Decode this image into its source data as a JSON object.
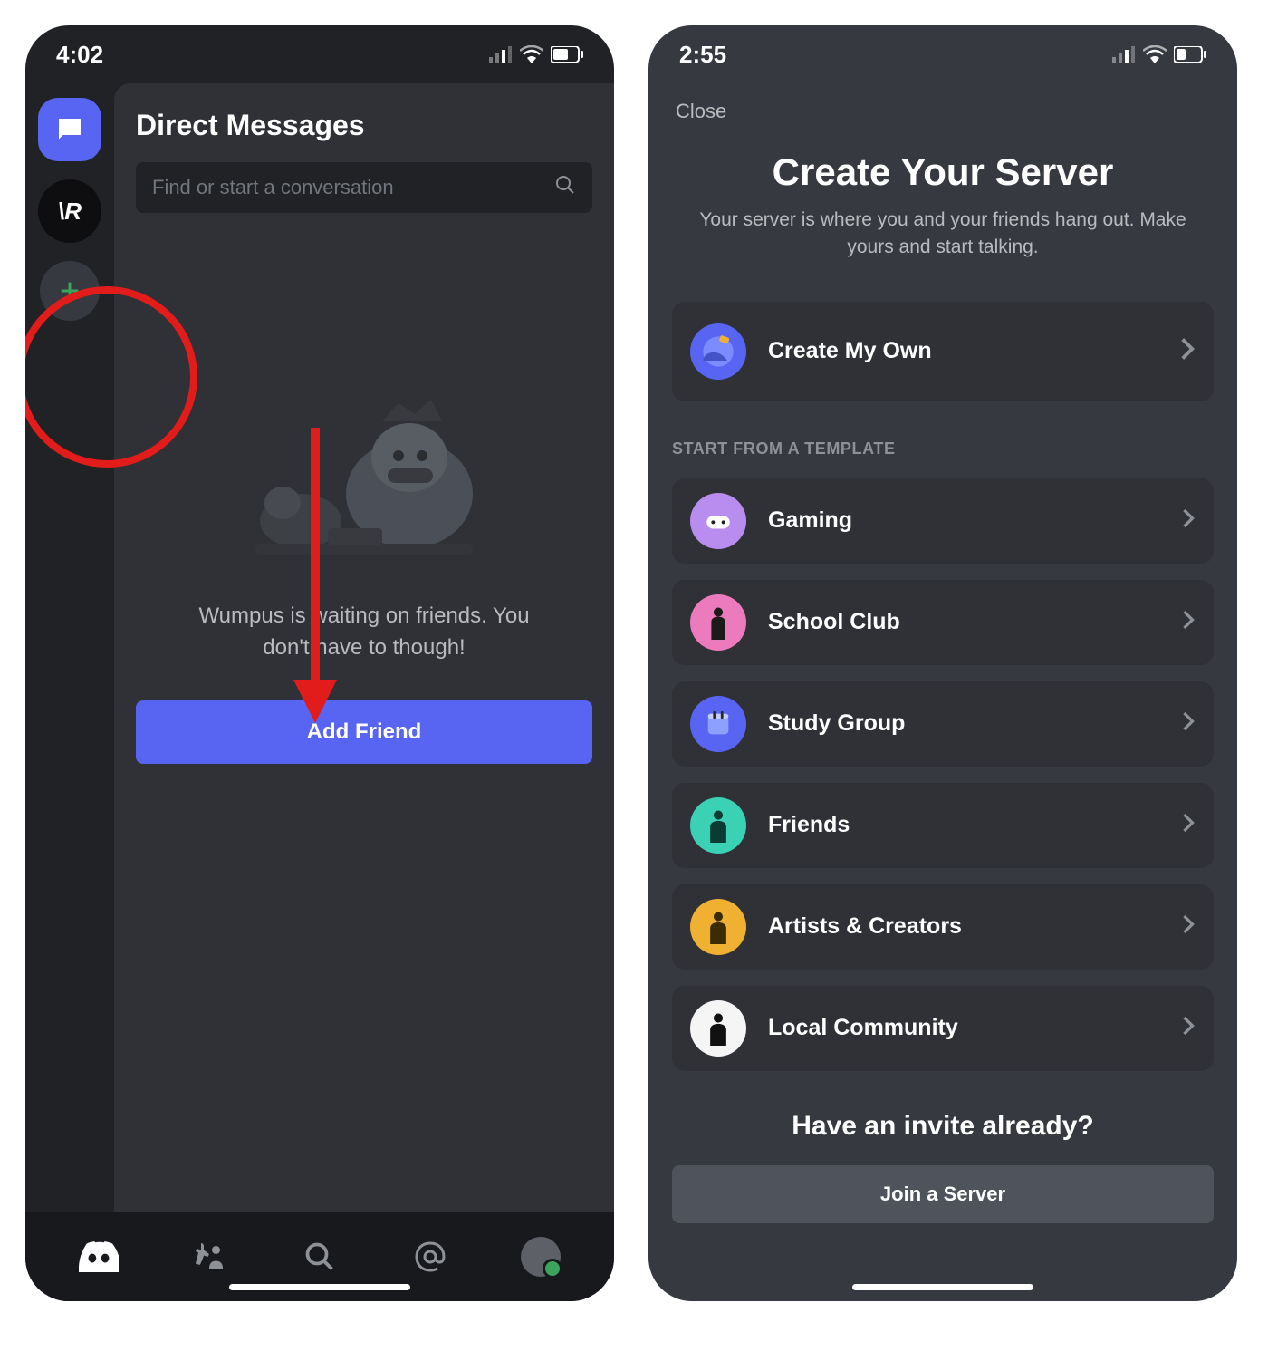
{
  "left": {
    "status_time": "4:02",
    "dm_title": "Direct Messages",
    "search_placeholder": "Find or start a conversation",
    "server_initials": "\\R",
    "empty_message": "Wumpus is waiting on friends. You don't have to though!",
    "add_friend_label": "Add Friend"
  },
  "right": {
    "status_time": "2:55",
    "close_label": "Close",
    "title": "Create Your Server",
    "subtitle": "Your server is where you and your friends hang out. Make yours and start talking.",
    "create_own_label": "Create My Own",
    "template_heading": "START FROM A TEMPLATE",
    "templates": [
      {
        "label": "Gaming",
        "color": "#b98cf0"
      },
      {
        "label": "School Club",
        "color": "#ec7bbd"
      },
      {
        "label": "Study Group",
        "color": "#5865f2"
      },
      {
        "label": "Friends",
        "color": "#3bd1b4"
      },
      {
        "label": "Artists & Creators",
        "color": "#f0b132"
      },
      {
        "label": "Local Community",
        "color": "#f5f5f5"
      }
    ],
    "invite_title": "Have an invite already?",
    "join_label": "Join a Server"
  },
  "colors": {
    "blurple": "#5865f2",
    "green": "#3ba55d",
    "card": "#2f3136",
    "bg_dark": "#202225"
  }
}
